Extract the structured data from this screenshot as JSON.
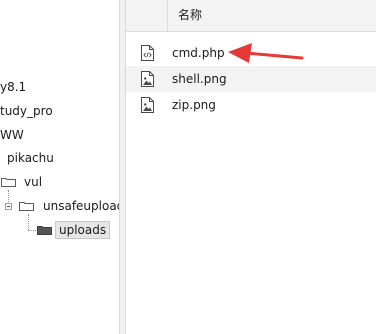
{
  "tree": {
    "items": [
      {
        "label": "y8.1"
      },
      {
        "label": "tudy_pro"
      },
      {
        "label": "WW"
      },
      {
        "label": "pikachu"
      },
      {
        "label": "vul"
      },
      {
        "label": "unsafeupload"
      },
      {
        "label": "uploads"
      }
    ]
  },
  "file_list": {
    "header": {
      "name_label": "名称"
    },
    "files": [
      {
        "name": "cmd.php",
        "icon": "php-file-icon"
      },
      {
        "name": "shell.png",
        "icon": "image-file-icon"
      },
      {
        "name": "zip.png",
        "icon": "image-file-icon"
      }
    ]
  },
  "annotation": {
    "arrow_color": "#e53935"
  }
}
